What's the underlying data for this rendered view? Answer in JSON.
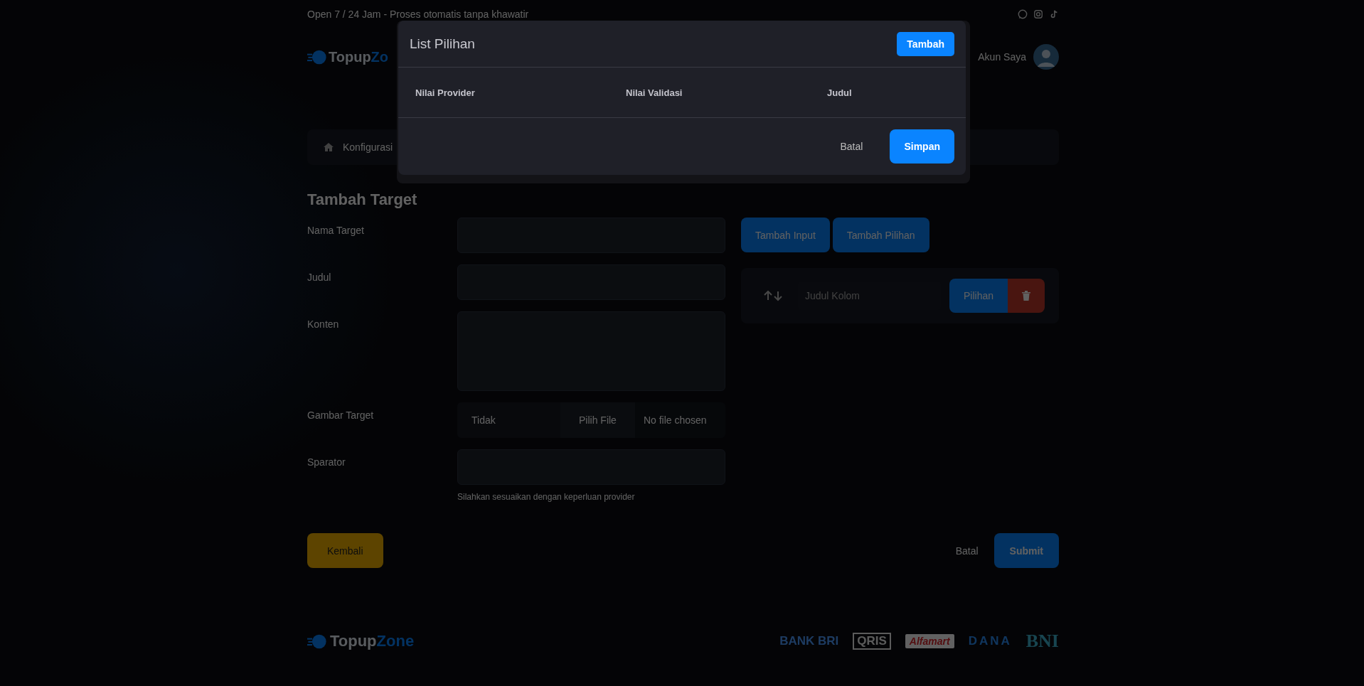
{
  "top_bar": {
    "text": "Open 7 / 24 Jam - Proses otomatis tanpa khawatir"
  },
  "header": {
    "logo_main": "Topup",
    "logo_accent": "Zo",
    "account": "Akun Saya"
  },
  "breadcrumb": [
    "Konfigurasi"
  ],
  "form": {
    "title": "Tambah Target",
    "fields": [
      {
        "label": "Nama Target",
        "kind": "input"
      },
      {
        "label": "Judul",
        "kind": "input"
      },
      {
        "label": "Konten",
        "kind": "textarea"
      },
      {
        "label": "Gambar Target",
        "kind": "file",
        "select_value": "Tidak",
        "button": "Pilih File",
        "file_status": "No file chosen"
      },
      {
        "label": "Sparator",
        "kind": "input",
        "hint": "Silahkan sesuaikan dengan keperluan provider"
      }
    ]
  },
  "builder": {
    "buttons": [
      "Tambah Input",
      "Tambah Pilihan"
    ],
    "rows": [
      {
        "placeholder": "Judul Kolom",
        "button": "Pilihan"
      }
    ]
  },
  "actions": {
    "back": "Kembali",
    "cancel": "Batal",
    "submit": "Submit"
  },
  "footer": {
    "logo_main": "Topup",
    "logo_accent": "Zone",
    "payment_logos": [
      "BANK BRI",
      "QRIS",
      "Alfamart",
      "DANA",
      "BNI"
    ]
  },
  "modal": {
    "title": "List Pilihan",
    "add_button": "Tambah",
    "columns": [
      "Nilai Provider",
      "Nilai Validasi",
      "Judul"
    ],
    "cancel": "Batal",
    "save": "Simpan"
  }
}
